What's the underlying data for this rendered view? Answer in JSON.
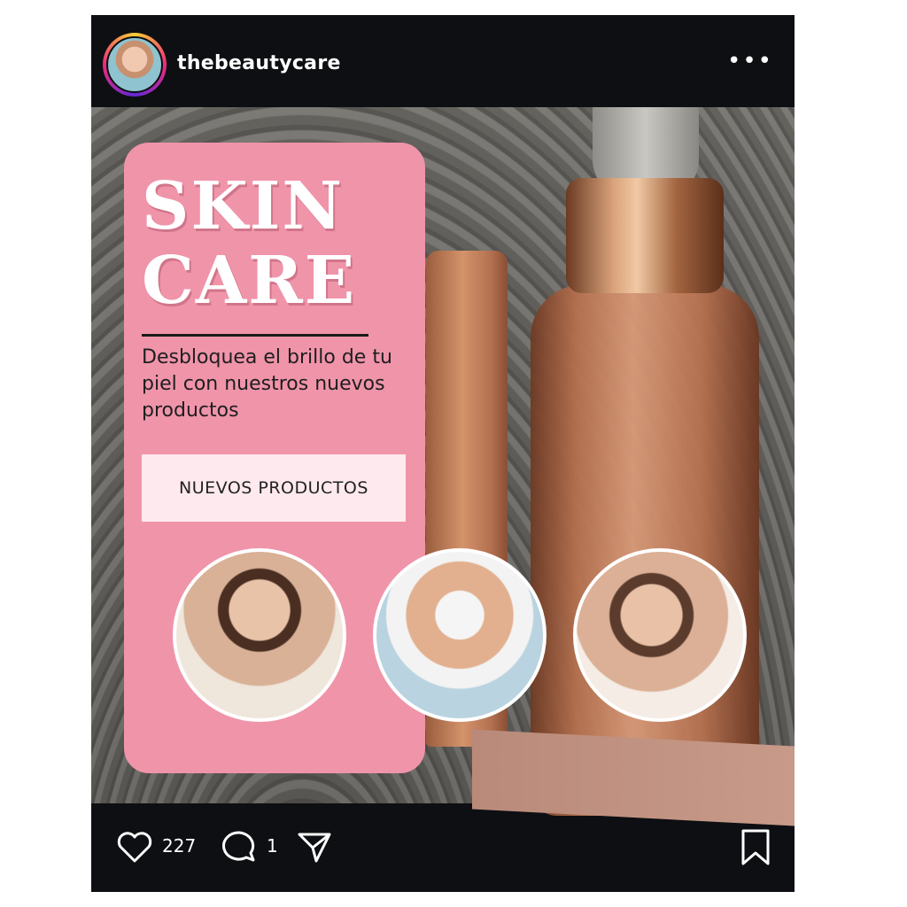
{
  "header": {
    "username": "thebeautycare",
    "more_icon": "more-horizontal-icon"
  },
  "post": {
    "headline": "SKIN CARE",
    "tagline": "Desbloquea el brillo de tu piel con nuestros nuevos productos",
    "cta_label": "NUEVOS PRODUCTOS"
  },
  "footer": {
    "likes": "227",
    "comments": "1"
  },
  "colors": {
    "card": "#f094aa",
    "cta_bg": "#fde9ee",
    "frame": "#0d0f12"
  }
}
